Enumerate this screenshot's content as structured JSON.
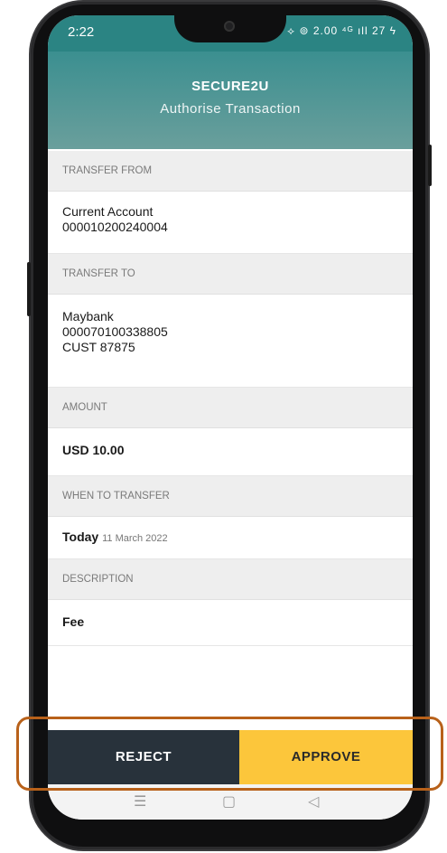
{
  "status_bar": {
    "time": "2:22",
    "icons_text": "⟡ ⊚ 2.00 ⁴ᴳ ıll 27 ϟ"
  },
  "header": {
    "title": "SECURE2U",
    "subtitle": "Authorise Transaction"
  },
  "transfer_from": {
    "label": "TRANSFER FROM",
    "account_name": "Current Account",
    "account_number": "000010200240004"
  },
  "transfer_to": {
    "label": "TRANSFER TO",
    "bank": "Maybank",
    "account_number": "000070100338805",
    "reference": "CUST 87875"
  },
  "amount": {
    "label": "AMOUNT",
    "value": "USD 10.00"
  },
  "when_to_transfer": {
    "label": "WHEN TO TRANSFER",
    "day": "Today",
    "date": "11 March 2022"
  },
  "description": {
    "label": "DESCRIPTION",
    "value": "Fee"
  },
  "actions": {
    "reject_label": "REJECT",
    "approve_label": "APPROVE"
  },
  "navbar": {
    "menu_glyph": "☰",
    "home_glyph": "▢",
    "back_glyph": "◁"
  },
  "colors": {
    "header": "#3b8f90",
    "reject": "#28323b",
    "approve": "#fcc63b",
    "highlight": "#b8611a"
  }
}
